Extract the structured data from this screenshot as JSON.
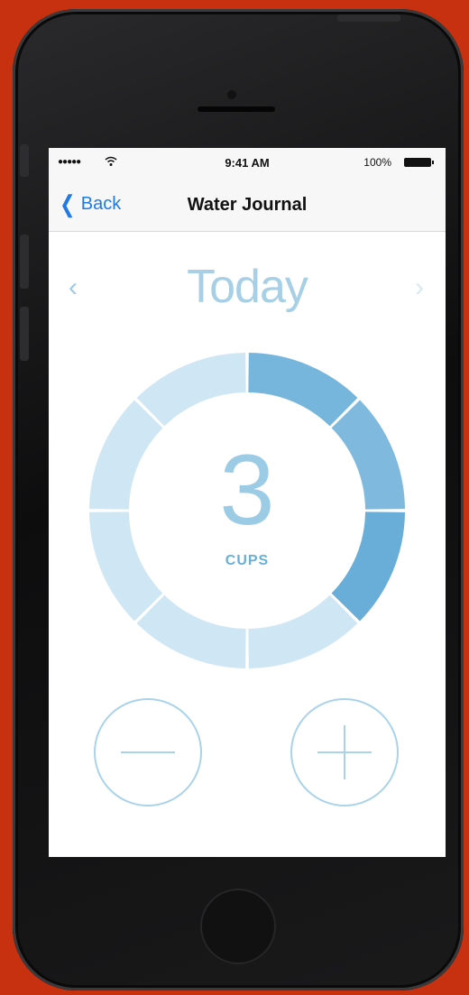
{
  "status_bar": {
    "signal": "●●●●●",
    "time": "9:41 AM",
    "battery": "100%"
  },
  "nav": {
    "back_label": "Back",
    "title": "Water Journal"
  },
  "day": {
    "label": "Today",
    "prev_arrow": "‹",
    "next_arrow": "›"
  },
  "tracker": {
    "count": "3",
    "unit": "CUPS",
    "segments_total": 8,
    "segments_filled": 3
  },
  "colors": {
    "background": "#c8310f",
    "accent": "#1f7ae8",
    "filled_segment": "#68aed8",
    "empty_segment": "#cfe6f4"
  },
  "icons": {
    "back": "chevron-left-icon",
    "wifi": "wifi-icon",
    "battery": "battery-icon",
    "minus": "minus-icon",
    "plus": "plus-icon"
  }
}
